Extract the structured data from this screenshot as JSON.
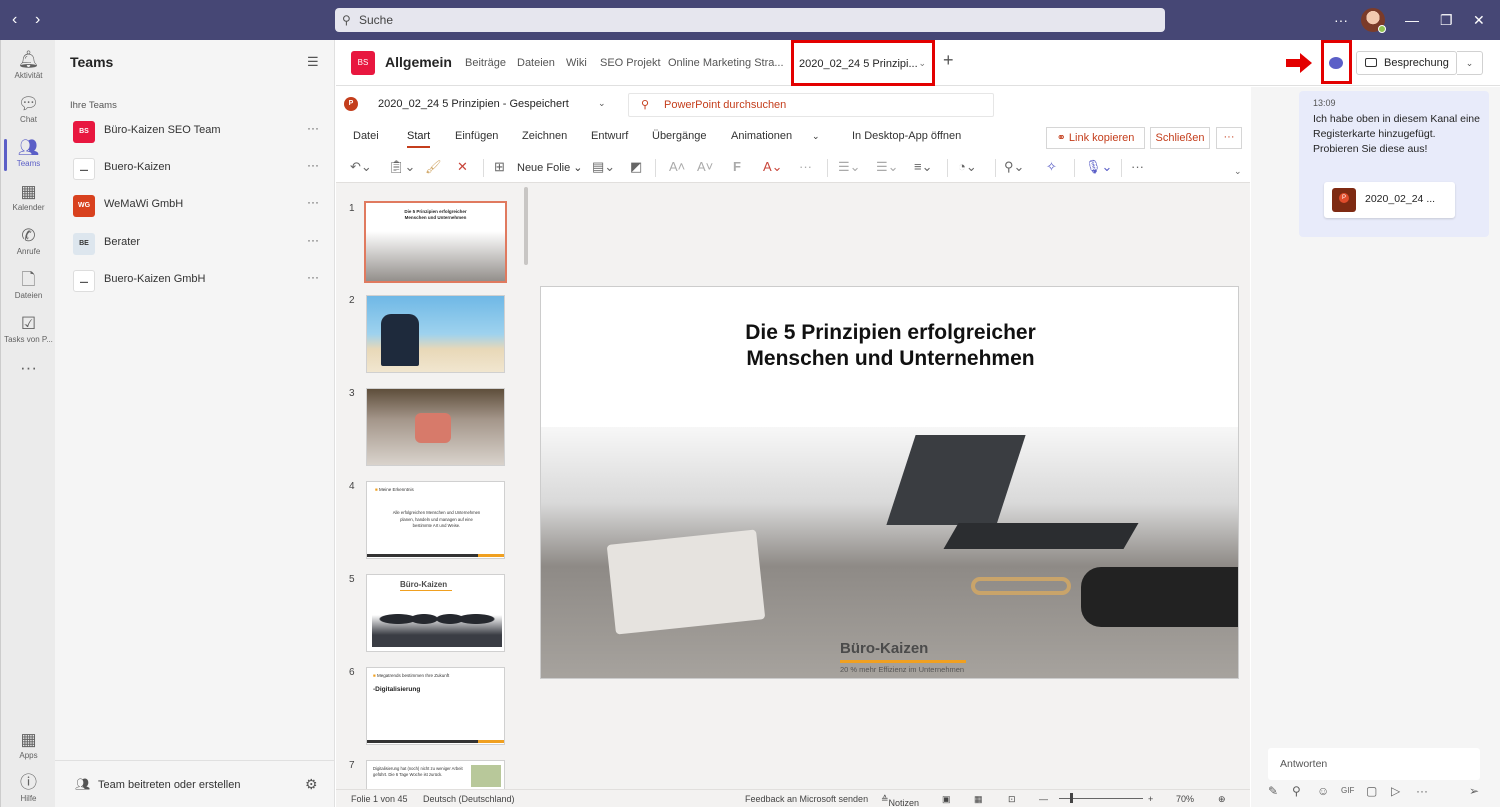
{
  "titlebar": {
    "search_placeholder": "Suche",
    "more": "···",
    "back": "‹",
    "forward": "›"
  },
  "rail": [
    {
      "id": "activity",
      "label": "Aktivität",
      "icon": "bell-icon"
    },
    {
      "id": "chat",
      "label": "Chat",
      "icon": "chat-icon"
    },
    {
      "id": "teams",
      "label": "Teams",
      "icon": "teams-icon",
      "active": true
    },
    {
      "id": "calendar",
      "label": "Kalender",
      "icon": "calendar-icon"
    },
    {
      "id": "calls",
      "label": "Anrufe",
      "icon": "phone-icon"
    },
    {
      "id": "files",
      "label": "Dateien",
      "icon": "file-icon"
    },
    {
      "id": "tasks",
      "label": "Tasks von P...",
      "icon": "tasks-icon"
    },
    {
      "id": "more",
      "label": "",
      "icon": "more-icon"
    }
  ],
  "rail_bottom": [
    {
      "id": "apps",
      "label": "Apps",
      "icon": "apps-icon"
    },
    {
      "id": "help",
      "label": "Hilfe",
      "icon": "help-icon"
    }
  ],
  "teams_pane": {
    "title": "Teams",
    "section": "Ihre Teams",
    "teams": [
      {
        "name": "Büro-Kaizen SEO Team",
        "badge": "BS",
        "color": "#e8173f"
      },
      {
        "name": "Buero-Kaizen",
        "badge": "",
        "color": "#ffffff"
      },
      {
        "name": "WeMaWi GmbH",
        "badge": "WG",
        "color": "#d8411e"
      },
      {
        "name": "Berater",
        "badge": "BE",
        "color": "#dde6ee"
      },
      {
        "name": "Buero-Kaizen GmbH",
        "badge": "",
        "color": "#ffffff"
      }
    ],
    "join_label": "Team beitreten oder erstellen"
  },
  "channel": {
    "badge": "BS",
    "name": "Allgemein",
    "tabs": [
      "Beiträge",
      "Dateien",
      "Wiki",
      "SEO Projekt",
      "Online Marketing Stra..."
    ],
    "active_tab": "2020_02_24 5 Prinzipi...",
    "meeting_label": "Besprechung"
  },
  "ppt": {
    "logo": "P",
    "file_title": "2020_02_24 5 Prinzipien  -  Gespeichert",
    "search_placeholder": "PowerPoint durchsuchen",
    "ribbon_tabs": [
      "Datei",
      "Start",
      "Einfügen",
      "Zeichnen",
      "Entwurf",
      "Übergänge",
      "Animationen",
      "In Desktop-App öffnen"
    ],
    "link_label": "Link kopieren",
    "close_label": "Schließen",
    "new_slide_label": "Neue Folie",
    "thumbnails": [
      "1",
      "2",
      "3",
      "4",
      "5",
      "6",
      "7"
    ],
    "thumb_texts": {
      "t1_title": "Die 5 Prinzipien erfolgreicher Menschen und Unternehmen",
      "t4_head": "Meine Erkenntnis",
      "t4_body": "Alle erfolgreichen Menschen und Unternehmen planen, handeln und managen auf eine bestimmte Art und Weise.",
      "t5_logo": "Büro-Kaizen",
      "t6_head": "Megatrends bestimmen Ihre Zukunft",
      "t6_body": "-Digitalisierung",
      "t7_head": "Digitalisierung hat (noch) nicht zu weniger Arbeit geführt. Die 6 Tage Woche ist zurück."
    },
    "slide": {
      "title_line1": "Die 5 Prinzipien erfolgreicher",
      "title_line2": "Menschen und Unternehmen",
      "logo": "Büro-Kaizen",
      "tagline": "20 % mehr Effizienz im Unternehmen"
    },
    "status": {
      "slide_count": "Folie 1 von 45",
      "language": "Deutsch (Deutschland)",
      "feedback": "Feedback an Microsoft senden",
      "notes": "Notizen",
      "zoom": "70%"
    }
  },
  "chat": {
    "time": "13:09",
    "message": "Ich habe oben in diesem Kanal eine Registerkarte hinzugefügt. Probieren Sie diese aus!",
    "file_name": "2020_02_24 ...",
    "reply_placeholder": "Antworten"
  }
}
